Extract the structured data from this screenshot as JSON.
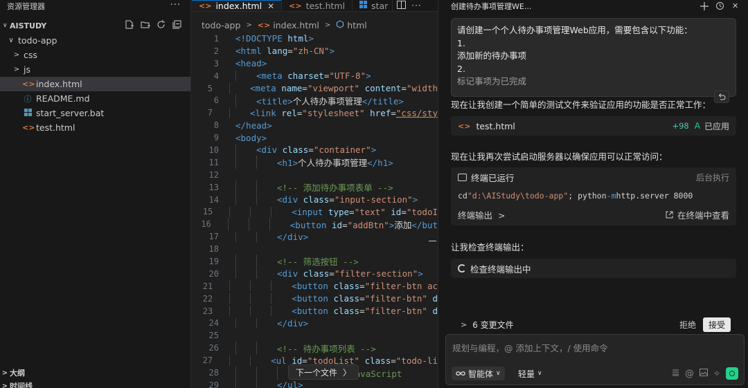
{
  "explorer": {
    "title": "资源管理器",
    "more": "···",
    "workspace": "AISTUDY",
    "tree": [
      {
        "label": "todo-app",
        "twisty": "∨",
        "icon": "",
        "indent": 1,
        "selected": false
      },
      {
        "label": "css",
        "twisty": ">",
        "icon": "",
        "indent": 2,
        "selected": false
      },
      {
        "label": "js",
        "twisty": ">",
        "icon": "",
        "indent": 2,
        "selected": false
      },
      {
        "label": "index.html",
        "twisty": "",
        "icon": "html",
        "indent": 2,
        "selected": true
      },
      {
        "label": "README.md",
        "twisty": "",
        "icon": "info",
        "indent": 2,
        "selected": false
      },
      {
        "label": "start_server.bat",
        "twisty": "",
        "icon": "bat",
        "indent": 2,
        "selected": false
      },
      {
        "label": "test.html",
        "twisty": "",
        "icon": "html",
        "indent": 2,
        "selected": false
      }
    ],
    "outline_label": "大纲",
    "timeline_label": "时间线"
  },
  "editor": {
    "tabs": [
      {
        "label": "index.html",
        "active": true
      },
      {
        "label": "test.html",
        "active": false
      },
      {
        "label": "star",
        "active": false
      }
    ],
    "breadcrumb": [
      "todo-app",
      "index.html",
      "html"
    ],
    "lines": [
      {
        "n": "1",
        "indent": 0,
        "tokens": [
          [
            "t-doc",
            "<!DOCTYPE "
          ],
          [
            "t-attr",
            "html"
          ],
          [
            "t-doc",
            ">"
          ]
        ]
      },
      {
        "n": "2",
        "indent": 0,
        "tokens": [
          [
            "t-tag",
            "<html "
          ],
          [
            "t-attr",
            "lang"
          ],
          [
            "t-txt",
            "="
          ],
          [
            "t-str",
            "\"zh-CN\""
          ],
          [
            "t-tag",
            ">"
          ]
        ]
      },
      {
        "n": "3",
        "indent": 0,
        "tokens": [
          [
            "t-tag",
            "<head>"
          ]
        ]
      },
      {
        "n": "4",
        "indent": 1,
        "tokens": [
          [
            "t-tag",
            "<meta "
          ],
          [
            "t-attr",
            "charset"
          ],
          [
            "t-txt",
            "="
          ],
          [
            "t-str",
            "\"UTF-8\""
          ],
          [
            "t-tag",
            ">"
          ]
        ]
      },
      {
        "n": "5",
        "indent": 1,
        "tokens": [
          [
            "t-tag",
            "<meta "
          ],
          [
            "t-attr",
            "name"
          ],
          [
            "t-txt",
            "="
          ],
          [
            "t-str",
            "\"viewport\""
          ],
          [
            "t-txt",
            " "
          ],
          [
            "t-attr",
            "content"
          ],
          [
            "t-txt",
            "="
          ],
          [
            "t-str",
            "\"width"
          ]
        ]
      },
      {
        "n": "6",
        "indent": 1,
        "tokens": [
          [
            "t-tag",
            "<title>"
          ],
          [
            "t-txt",
            "个人待办事项管理"
          ],
          [
            "t-tag",
            "</title>"
          ]
        ]
      },
      {
        "n": "7",
        "indent": 1,
        "tokens": [
          [
            "t-tag",
            "<link "
          ],
          [
            "t-attr",
            "rel"
          ],
          [
            "t-txt",
            "="
          ],
          [
            "t-str",
            "\"stylesheet\""
          ],
          [
            "t-txt",
            " "
          ],
          [
            "t-attr",
            "href"
          ],
          [
            "t-txt",
            "="
          ],
          [
            "t-str t-link",
            "\"css/sty"
          ]
        ]
      },
      {
        "n": "8",
        "indent": 0,
        "tokens": [
          [
            "t-tag",
            "</head>"
          ]
        ]
      },
      {
        "n": "9",
        "indent": 0,
        "tokens": [
          [
            "t-tag",
            "<body>"
          ]
        ]
      },
      {
        "n": "10",
        "indent": 1,
        "tokens": [
          [
            "t-tag",
            "<div "
          ],
          [
            "t-attr",
            "class"
          ],
          [
            "t-txt",
            "="
          ],
          [
            "t-str",
            "\"container\""
          ],
          [
            "t-tag",
            ">"
          ]
        ]
      },
      {
        "n": "11",
        "indent": 2,
        "tokens": [
          [
            "t-tag",
            "<h1>"
          ],
          [
            "t-txt",
            "个人待办事项管理"
          ],
          [
            "t-tag",
            "</h1>"
          ]
        ]
      },
      {
        "n": "12",
        "indent": 0,
        "tokens": []
      },
      {
        "n": "13",
        "indent": 2,
        "tokens": [
          [
            "t-cmt",
            "<!-- 添加待办事项表单 -->"
          ]
        ]
      },
      {
        "n": "14",
        "indent": 2,
        "tokens": [
          [
            "t-tag",
            "<div "
          ],
          [
            "t-attr",
            "class"
          ],
          [
            "t-txt",
            "="
          ],
          [
            "t-str",
            "\"input-section\""
          ],
          [
            "t-tag",
            ">"
          ]
        ]
      },
      {
        "n": "15",
        "indent": 3,
        "tokens": [
          [
            "t-tag",
            "<input "
          ],
          [
            "t-attr",
            "type"
          ],
          [
            "t-txt",
            "="
          ],
          [
            "t-str",
            "\"text\""
          ],
          [
            "t-txt",
            " "
          ],
          [
            "t-attr",
            "id"
          ],
          [
            "t-txt",
            "="
          ],
          [
            "t-str",
            "\"todoI"
          ]
        ]
      },
      {
        "n": "16",
        "indent": 3,
        "tokens": [
          [
            "t-tag",
            "<button "
          ],
          [
            "t-attr",
            "id"
          ],
          [
            "t-txt",
            "="
          ],
          [
            "t-str",
            "\"addBtn\""
          ],
          [
            "t-tag",
            ">"
          ],
          [
            "t-txt",
            "添加"
          ],
          [
            "t-tag",
            "</but"
          ]
        ]
      },
      {
        "n": "17",
        "indent": 2,
        "tokens": [
          [
            "t-tag",
            "</div>"
          ]
        ]
      },
      {
        "n": "18",
        "indent": 0,
        "tokens": []
      },
      {
        "n": "19",
        "indent": 2,
        "tokens": [
          [
            "t-cmt",
            "<!-- 筛选按钮 -->"
          ]
        ]
      },
      {
        "n": "20",
        "indent": 2,
        "tokens": [
          [
            "t-tag",
            "<div "
          ],
          [
            "t-attr",
            "class"
          ],
          [
            "t-txt",
            "="
          ],
          [
            "t-str",
            "\"filter-section\""
          ],
          [
            "t-tag",
            ">"
          ]
        ]
      },
      {
        "n": "21",
        "indent": 3,
        "tokens": [
          [
            "t-tag",
            "<button "
          ],
          [
            "t-attr",
            "class"
          ],
          [
            "t-txt",
            "="
          ],
          [
            "t-str",
            "\"filter-btn ac"
          ]
        ]
      },
      {
        "n": "22",
        "indent": 3,
        "tokens": [
          [
            "t-tag",
            "<button "
          ],
          [
            "t-attr",
            "class"
          ],
          [
            "t-txt",
            "="
          ],
          [
            "t-str",
            "\"filter-btn\""
          ],
          [
            "t-txt",
            " "
          ],
          [
            "t-attr",
            "d"
          ]
        ]
      },
      {
        "n": "23",
        "indent": 3,
        "tokens": [
          [
            "t-tag",
            "<button "
          ],
          [
            "t-attr",
            "class"
          ],
          [
            "t-txt",
            "="
          ],
          [
            "t-str",
            "\"filter-btn\""
          ],
          [
            "t-txt",
            " "
          ],
          [
            "t-attr",
            "d"
          ]
        ]
      },
      {
        "n": "24",
        "indent": 2,
        "tokens": [
          [
            "t-tag",
            "</div>"
          ]
        ]
      },
      {
        "n": "25",
        "indent": 0,
        "tokens": []
      },
      {
        "n": "26",
        "indent": 2,
        "tokens": [
          [
            "t-cmt",
            "<!-- 待办事项列表 -->"
          ]
        ]
      },
      {
        "n": "27",
        "indent": 2,
        "tokens": [
          [
            "t-tag",
            "<ul "
          ],
          [
            "t-attr",
            "id"
          ],
          [
            "t-txt",
            "="
          ],
          [
            "t-str",
            "\"todoList\""
          ],
          [
            "t-txt",
            " "
          ],
          [
            "t-attr",
            "class"
          ],
          [
            "t-txt",
            "="
          ],
          [
            "t-str",
            "\"todo-li"
          ]
        ]
      },
      {
        "n": "28",
        "indent": 3,
        "tokens": [
          [
            "t-cmt",
            "<!-- 将通过JavaScript"
          ]
        ]
      },
      {
        "n": "29",
        "indent": 2,
        "tokens": [
          [
            "t-tag",
            "</ul>"
          ]
        ]
      }
    ],
    "next_file": "下一个文件",
    "next_file_arrow": "〉"
  },
  "chat": {
    "title": "创建待办事项管理WE...",
    "user_message": [
      "请创建一个个人待办事项管理Web应用，需要包含以下功能：",
      "1.",
      "添加新的待办事项",
      "2.",
      "标记事项为已完成"
    ],
    "msg1": "现在让我创建一个简单的测试文件来验证应用的功能是否正常工作：",
    "file_card": {
      "name": "test.html",
      "added": "+98",
      "status_letter": "A",
      "status": "已应用"
    },
    "msg2": "现在让我再次尝试启动服务器以确保应用可以正常访问：",
    "terminal": {
      "status": "终端已运行",
      "mode": "后台执行",
      "cmd_prefix": "cd ",
      "cmd_path": "\"d:\\AIStudy\\todo-app\"",
      "cmd_sep": "; python ",
      "cmd_flag": "-m",
      "cmd_rest": " http.server 8000",
      "output_label": "终端输出",
      "view_in_terminal": "在终端中查看"
    },
    "msg3": "让我检查终端输出：",
    "checking": "检查终端输出中",
    "changes": {
      "count": "6 变更文件",
      "reject": "拒绝",
      "accept": "接受"
    },
    "input": {
      "placeholder": "规划与编程，@ 添加上下文，/ 使用命令",
      "agent": "智能体",
      "light": "轻量"
    }
  },
  "colors": {
    "accent": "#0078d4",
    "success": "#23d18b",
    "html_icon": "#e37933"
  }
}
